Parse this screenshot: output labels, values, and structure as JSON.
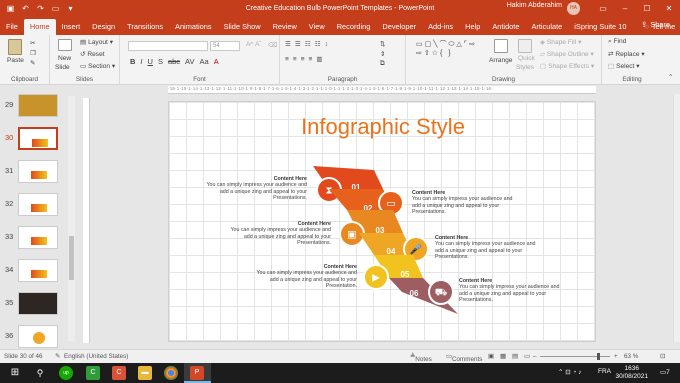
{
  "titlebar": {
    "title": "Creative Education Bulb PowerPoint Templates  -  PowerPoint",
    "user": "Hakim Abderahim",
    "avatar_initials": "HA",
    "qa_icons": [
      "save-icon",
      "undo-icon",
      "redo-icon",
      "present-icon",
      "customize-icon"
    ],
    "controls": [
      "ribbon-display-icon",
      "minimize-icon",
      "maximize-icon",
      "close-icon"
    ]
  },
  "tabs": [
    "File",
    "Home",
    "Insert",
    "Design",
    "Transitions",
    "Animations",
    "Slide Show",
    "Review",
    "View",
    "Recording",
    "Developer",
    "Add-ins",
    "Help",
    "Antidote",
    "Articulate",
    "iSpring Suite 10"
  ],
  "active_tab": "Home",
  "tellme": "Tell me",
  "share": "Share",
  "ribbon": {
    "clipboard": {
      "paste": "Paste",
      "label": "Clipboard"
    },
    "slides": {
      "new_slide": "New",
      "new_slide2": "Slide",
      "layout": "Layout",
      "reset": "Reset",
      "section": "Section",
      "label": "Slides"
    },
    "font": {
      "size": "54",
      "label": "Font",
      "buttons": [
        "B",
        "I",
        "U",
        "S",
        "abc",
        "AV",
        "Aa",
        "A"
      ]
    },
    "paragraph": {
      "label": "Paragraph"
    },
    "drawing": {
      "arrange": "Arrange",
      "quick_styles": "Quick",
      "quick_styles2": "Styles",
      "shape_fill": "Shape Fill",
      "shape_outline": "Shape Outline",
      "shape_effects": "Shape Effects",
      "label": "Drawing"
    },
    "editing": {
      "find": "Find",
      "replace": "Replace",
      "select": "Select",
      "label": "Editing"
    }
  },
  "ruler_text": "·16·1·15·1·14·1·13·1·12·1·11·1·10·1·9·1·8·1·7·1·6·1·5·1·4·1·3·1·2·1·1·1·0·1·1·1·2·1·3·1·4·1·5·1·6·1·7·1·8·1·9·1·10·1·11·1·12·1·13·1·14·1·15·1·16·",
  "thumbnails": [
    {
      "num": "29"
    },
    {
      "num": "30",
      "active": true
    },
    {
      "num": "31"
    },
    {
      "num": "32"
    },
    {
      "num": "33"
    },
    {
      "num": "34"
    },
    {
      "num": "35"
    },
    {
      "num": "36"
    }
  ],
  "slide": {
    "title": "Infographic Style",
    "steps": [
      {
        "num": "01",
        "color": "#e2491c",
        "icon": "hourglass-icon"
      },
      {
        "num": "02",
        "color": "#e6611c",
        "icon": "chat-icon"
      },
      {
        "num": "03",
        "color": "#e98720",
        "icon": "presentation-icon"
      },
      {
        "num": "04",
        "color": "#efa625",
        "icon": "microphone-icon"
      },
      {
        "num": "05",
        "color": "#f2c31e",
        "icon": "play-icon"
      },
      {
        "num": "06",
        "color": "#9e5d60",
        "icon": "car-icon"
      }
    ],
    "content": [
      {
        "heading": "Content  Here",
        "lines": [
          "You can simply impress your audience and",
          "add a unique zing and appeal to your",
          "Presentations."
        ]
      },
      {
        "heading": "Content  Here",
        "lines": [
          "You can simply impress your audience and",
          "add a unique zing and appeal to your",
          "Presentations."
        ]
      },
      {
        "heading": "Content  Here",
        "lines": [
          "You can simply impress your audience and",
          "add a unique zing and appeal to your",
          "Presentations."
        ]
      },
      {
        "heading": "Content  Here",
        "lines": [
          "You can simply impress your audience and",
          "add a unique zing and appeal to your",
          "Presentations."
        ]
      },
      {
        "heading": "Content  Here",
        "lines": [
          "You can simply impress your audience and",
          "add a unique zing and appeal to your",
          "Presentation."
        ]
      },
      {
        "heading": "Content  Here",
        "lines": [
          "You can simply impress your audience and",
          "add a unique zing and appeal to your",
          "Presentations."
        ]
      }
    ]
  },
  "status": {
    "slide": "Slide 30 of 46",
    "language": "English (United States)",
    "notes": "Notes",
    "comments": "Comments",
    "zoom": "63 %"
  },
  "taskbar": {
    "apps": [
      "start-icon",
      "search-icon",
      "upwork-icon",
      "camtasia-icon",
      "camtasia-recorder-icon",
      "file-explorer-icon",
      "chrome-icon",
      "powerpoint-icon"
    ],
    "lang": "FRA",
    "time": "1636",
    "date": "30/08/2021",
    "notifications": "7"
  },
  "colors": {
    "accent": "#c43e1c",
    "title_orange": "#e8731b"
  }
}
